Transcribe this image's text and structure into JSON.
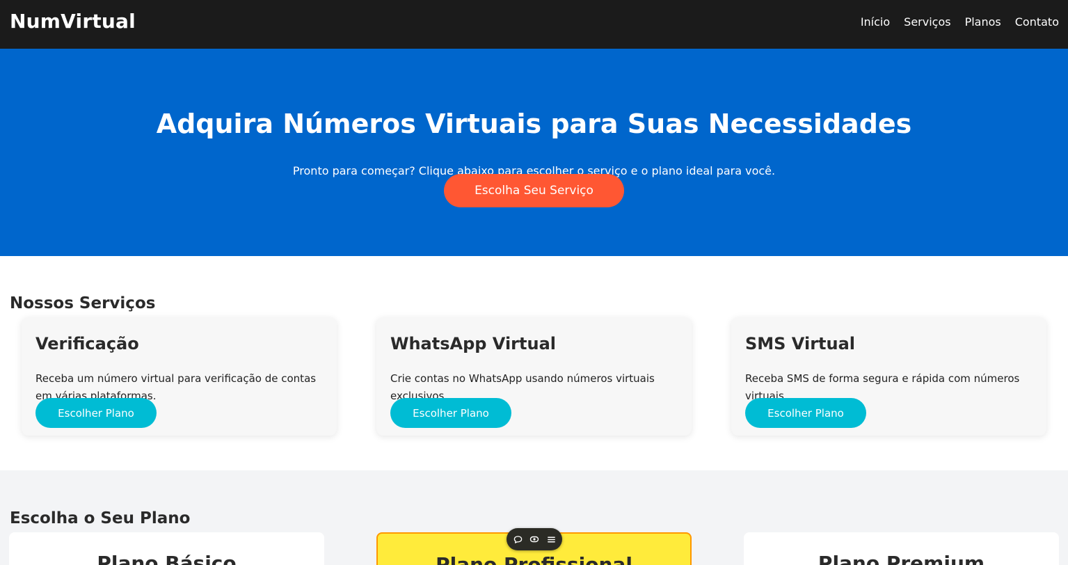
{
  "header": {
    "brand": "NumVirtual",
    "nav": [
      "Início",
      "Serviços",
      "Planos",
      "Contato"
    ]
  },
  "hero": {
    "title": "Adquira Números Virtuais para Suas Necessidades",
    "subtitle": "Pronto para começar? Clique abaixo para escolher o serviço e o plano ideal para você.",
    "button_label": "Escolha Seu Serviço"
  },
  "services": {
    "title": "Nossos Serviços",
    "cards": [
      {
        "title": "Verificação",
        "description": "Receba um número virtual para verificação de contas em várias plataformas.",
        "button_label": "Escolher Plano"
      },
      {
        "title": "WhatsApp Virtual",
        "description": "Crie contas no WhatsApp usando números virtuais exclusivos.",
        "button_label": "Escolher Plano"
      },
      {
        "title": "SMS Virtual",
        "description": "Receba SMS de forma segura e rápida com números virtuais.",
        "button_label": "Escolher Plano"
      }
    ]
  },
  "plans": {
    "title": "Escolha o Seu Plano",
    "items": [
      {
        "title": "Plano Básico"
      },
      {
        "title": "Plano Profissional"
      },
      {
        "title": "Plano Premium"
      }
    ]
  },
  "toolbar": {
    "icons": [
      "comment-icon",
      "eye-icon",
      "menu-icon"
    ]
  },
  "colors": {
    "topbar": "#1b1b1b",
    "hero_bg": "#0066cc",
    "hero_button": "#ff5733",
    "card_button": "#00bcd4",
    "featured_plan_bg": "#ffeb3b",
    "featured_plan_border": "#ff9800"
  }
}
